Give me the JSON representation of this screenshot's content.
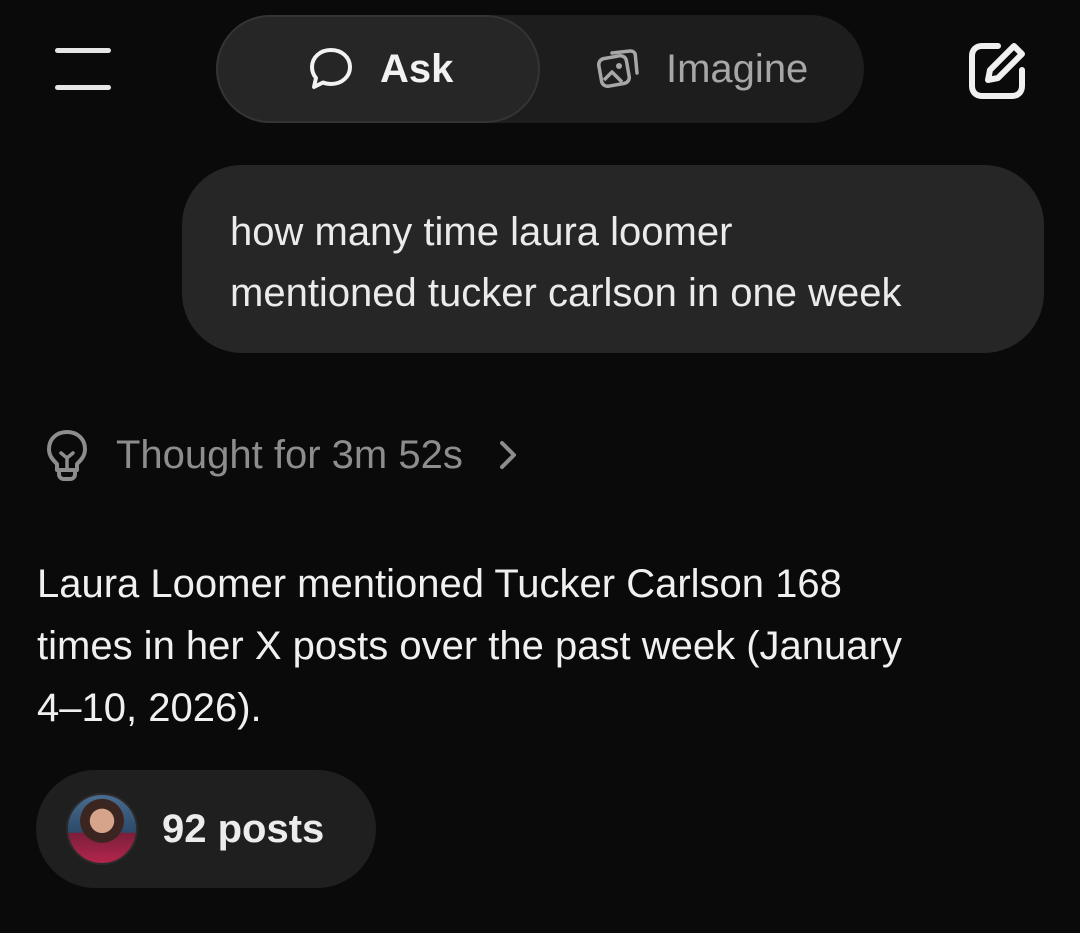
{
  "header": {
    "tabs": [
      {
        "label": "Ask",
        "icon": "speech-bubble-icon",
        "active": true
      },
      {
        "label": "Imagine",
        "icon": "image-stack-icon",
        "active": false
      }
    ],
    "menu_icon": "hamburger-menu-icon",
    "new_chat_icon": "edit-square-icon"
  },
  "user_message": {
    "line1": "how many time laura loomer",
    "line2": "mentioned tucker carlson in one week"
  },
  "thought": {
    "label": "Thought for 3m 52s",
    "icon": "lightbulb-icon"
  },
  "answer": {
    "line1": "Laura Loomer mentioned Tucker Carlson 168",
    "line2": "times in her X posts over the past week (January",
    "line3": "4–10, 2026)."
  },
  "sources_chip": {
    "label": "92 posts"
  },
  "colors": {
    "background": "#0a0a0a",
    "bubble": "#262626",
    "muted_text": "#8d8d8d"
  }
}
